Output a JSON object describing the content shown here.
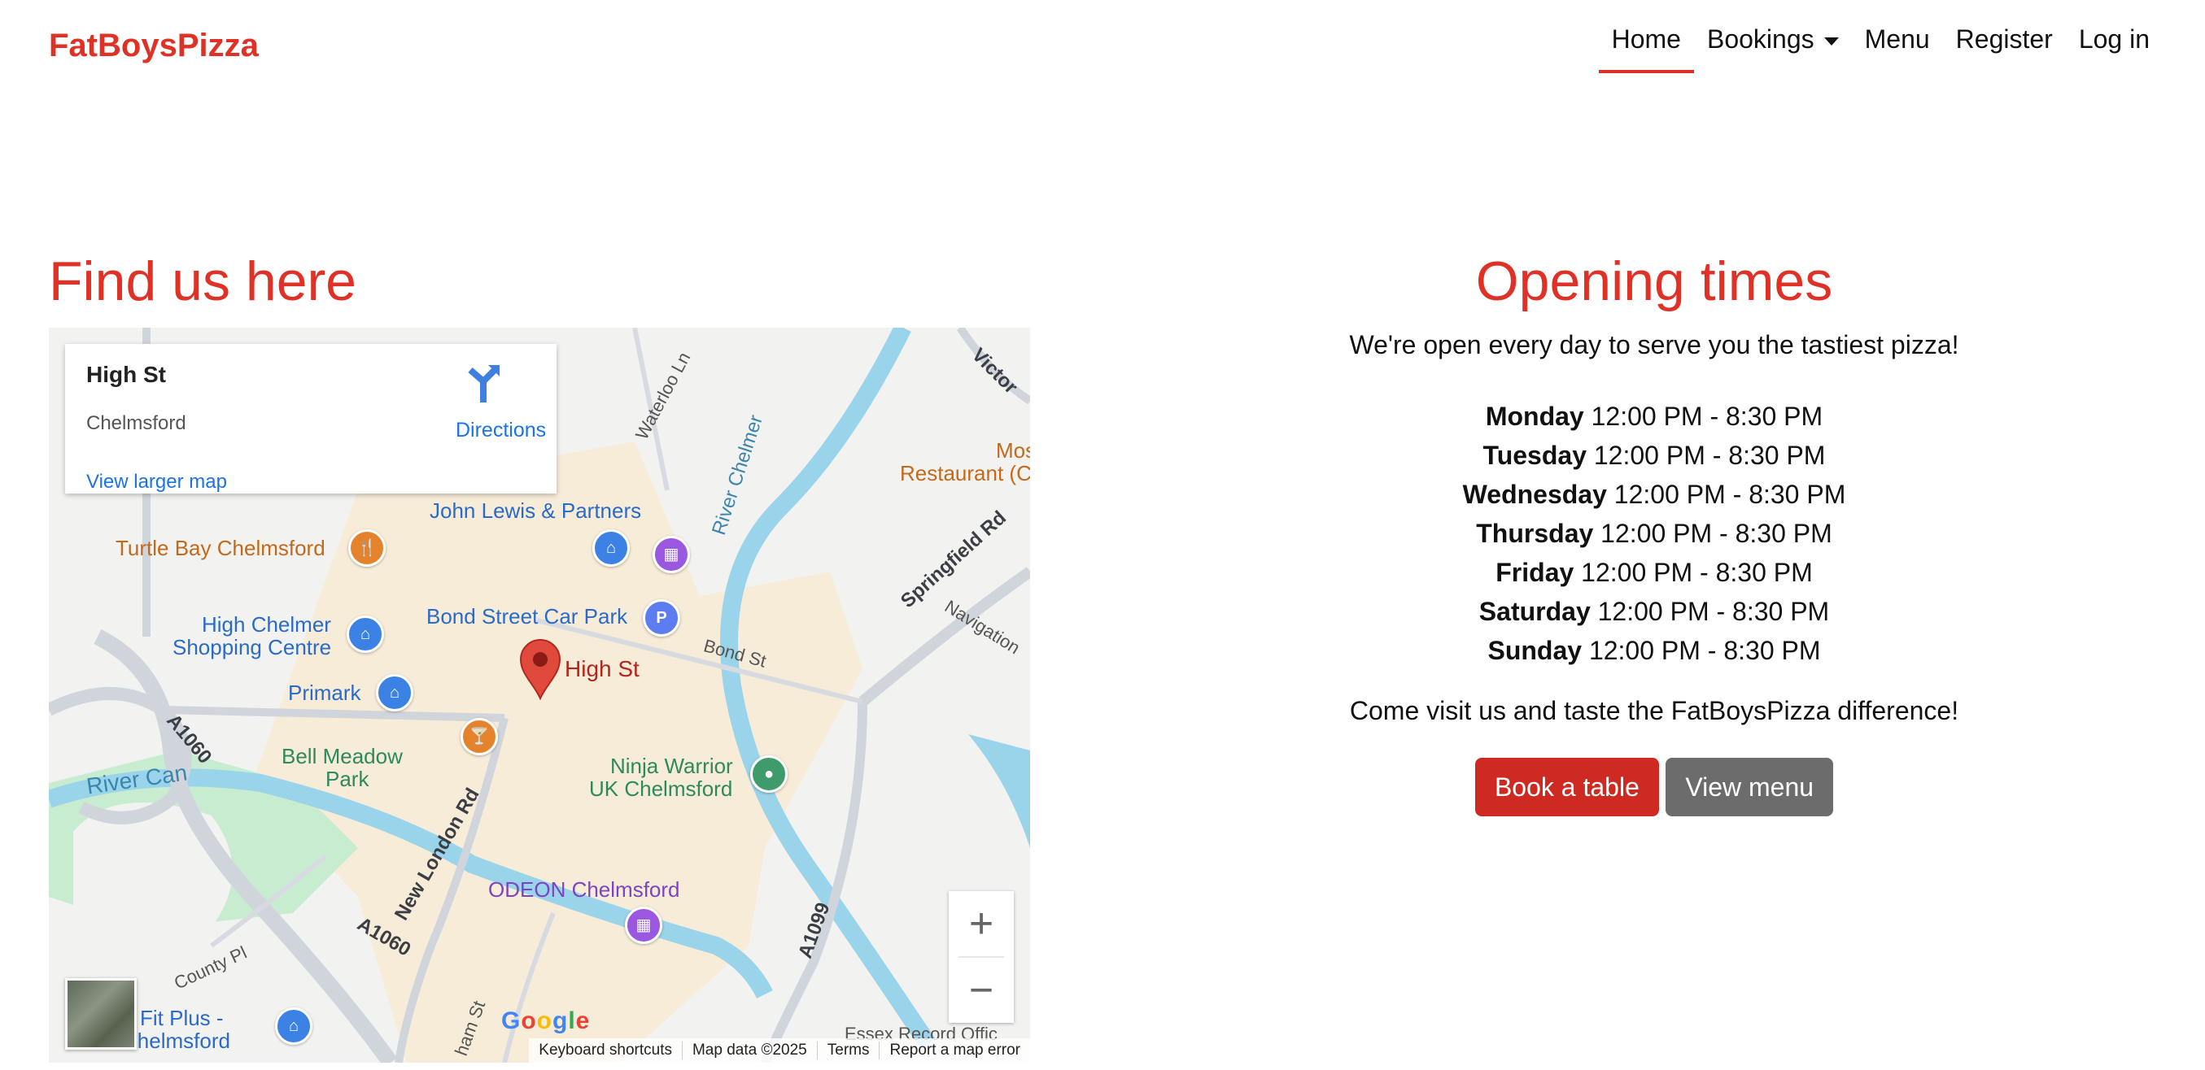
{
  "brand": "FatBoysPizza",
  "nav": {
    "home": "Home",
    "bookings": "Bookings",
    "menu": "Menu",
    "register": "Register",
    "login": "Log in"
  },
  "find": {
    "title": "Find us here",
    "map": {
      "place_title": "High St",
      "place_sub": "Chelmsford",
      "directions": "Directions",
      "view_larger": "View larger map",
      "pin_label": "High St",
      "labels": {
        "john_lewis": "John Lewis & Partners",
        "turtle_bay": "Turtle Bay Chelmsford",
        "high_chelmer_1": "High Chelmer",
        "high_chelmer_2": "Shopping Centre",
        "bond_street_car_park": "Bond Street Car Park",
        "primark": "Primark",
        "bond_st": "Bond St",
        "river_chelmer": "River Chelmer",
        "springfield_rd": "Springfield Rd",
        "navigation": "Navigation",
        "waterloo_ln": "Waterloo Ln",
        "victoria": "Victor",
        "restaurant": "Restaurant (C",
        "mos": "Mos",
        "a1060": "A1060",
        "a1060_b": "A1060",
        "river_can": "River Can",
        "bell_meadow_1": "Bell Meadow",
        "bell_meadow_2": "Park",
        "ninja_1": "Ninja Warrior",
        "ninja_2": "UK Chelmsford",
        "new_london_rd": "New London Rd",
        "odeon": "ODEON Chelmsford",
        "a1099": "A1099",
        "county_pl": "County Pl",
        "fit_plus_1": "Fit Plus -",
        "fit_plus_2": "Chelmsford",
        "essex_record": "Essex Record Offic",
        "ham_st": "ham St"
      },
      "google": "Google",
      "attribution": {
        "shortcuts": "Keyboard shortcuts",
        "mapdata": "Map data ©2025",
        "terms": "Terms",
        "report": "Report a map error"
      },
      "zoom_in": "+",
      "zoom_out": "−"
    }
  },
  "opening": {
    "title": "Opening times",
    "intro": "We're open every day to serve you the tastiest pizza!",
    "hours": [
      {
        "day": "Monday",
        "time": "12:00 PM - 8:30 PM"
      },
      {
        "day": "Tuesday",
        "time": "12:00 PM - 8:30 PM"
      },
      {
        "day": "Wednesday",
        "time": "12:00 PM - 8:30 PM"
      },
      {
        "day": "Thursday",
        "time": "12:00 PM - 8:30 PM"
      },
      {
        "day": "Friday",
        "time": "12:00 PM - 8:30 PM"
      },
      {
        "day": "Saturday",
        "time": "12:00 PM - 8:30 PM"
      },
      {
        "day": "Sunday",
        "time": "12:00 PM - 8:30 PM"
      }
    ],
    "visit": "Come visit us and taste the FatBoysPizza difference!",
    "book_button": "Book a table",
    "menu_button": "View menu"
  },
  "colors": {
    "brand_red": "#e03127",
    "button_red": "#cf2a21",
    "button_grey": "#6c6c6c"
  }
}
